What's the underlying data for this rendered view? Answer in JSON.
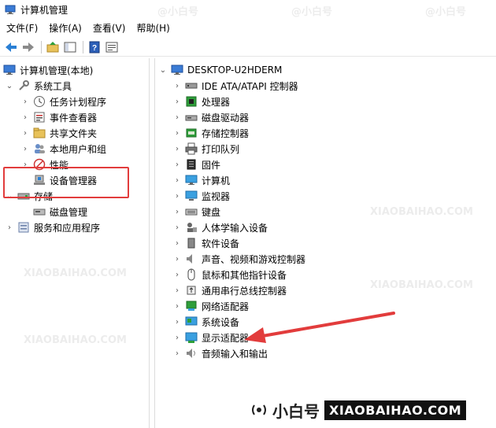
{
  "window": {
    "title": "计算机管理"
  },
  "menu": [
    {
      "label": "文件(F)"
    },
    {
      "label": "操作(A)"
    },
    {
      "label": "查看(V)"
    },
    {
      "label": "帮助(H)"
    }
  ],
  "left_tree": {
    "root": "计算机管理(本地)",
    "system_tools": "系统工具",
    "items": [
      {
        "label": "任务计划程序",
        "icon": "clock-icon"
      },
      {
        "label": "事件查看器",
        "icon": "event-viewer-icon"
      },
      {
        "label": "共享文件夹",
        "icon": "shared-folder-icon"
      },
      {
        "label": "本地用户和组",
        "icon": "users-icon"
      },
      {
        "label": "性能",
        "icon": "performance-icon"
      },
      {
        "label": "设备管理器",
        "icon": "device-manager-icon"
      }
    ],
    "storage": "存储",
    "disk_mgmt": "磁盘管理",
    "services": "服务和应用程序"
  },
  "right_tree": {
    "computer": "DESKTOP-U2HDERM",
    "devices": [
      {
        "label": "IDE ATA/ATAPI 控制器",
        "icon": "ide-controller-icon"
      },
      {
        "label": "处理器",
        "icon": "processor-icon"
      },
      {
        "label": "磁盘驱动器",
        "icon": "disk-drive-icon"
      },
      {
        "label": "存储控制器",
        "icon": "storage-controller-icon"
      },
      {
        "label": "打印队列",
        "icon": "printer-icon"
      },
      {
        "label": "固件",
        "icon": "firmware-icon"
      },
      {
        "label": "计算机",
        "icon": "computer-icon"
      },
      {
        "label": "监视器",
        "icon": "monitor-icon"
      },
      {
        "label": "键盘",
        "icon": "keyboard-icon"
      },
      {
        "label": "人体学输入设备",
        "icon": "hid-icon"
      },
      {
        "label": "软件设备",
        "icon": "software-device-icon"
      },
      {
        "label": "声音、视频和游戏控制器",
        "icon": "sound-icon"
      },
      {
        "label": "鼠标和其他指针设备",
        "icon": "mouse-icon"
      },
      {
        "label": "通用串行总线控制器",
        "icon": "usb-icon"
      },
      {
        "label": "网络适配器",
        "icon": "network-adapter-icon"
      },
      {
        "label": "系统设备",
        "icon": "system-device-icon"
      },
      {
        "label": "显示适配器",
        "icon": "display-adapter-icon"
      },
      {
        "label": "音频输入和输出",
        "icon": "audio-io-icon"
      }
    ]
  },
  "brand": {
    "cn": "小白号",
    "en": "XIAOBAIHAO.COM"
  },
  "watermark": {
    "text1": "@小白号",
    "text2": "XIAOBAIHAO.COM"
  },
  "colors": {
    "highlight_box": "#e23c3c",
    "arrow": "#e23c3c",
    "selection": "#cce8ff"
  }
}
